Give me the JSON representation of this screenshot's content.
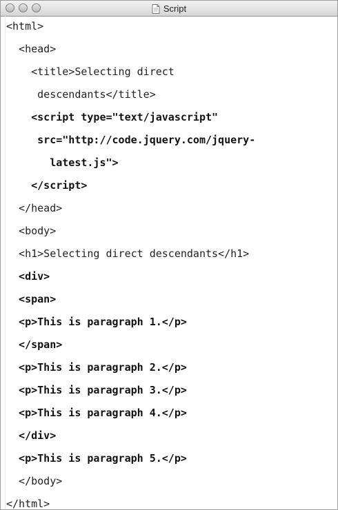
{
  "window": {
    "title": "Script",
    "title_icon": "document-icon"
  },
  "code": {
    "lines": [
      "<html>",
      "  <head>",
      "    <title>Selecting direct",
      "     descendants</title>",
      "    <script type=\"text/javascript\"",
      "     src=\"http://code.jquery.com/jquery-",
      "       latest.js\">",
      "    </script>",
      "  </head>",
      "  <body>",
      "  <h1>Selecting direct descendants</h1>",
      "  <div>",
      "  <span>",
      "  <p>This is paragraph 1.</p>",
      "  </span>",
      "  <p>This is paragraph 2.</p>",
      "  <p>This is paragraph 3.</p>",
      "  <p>This is paragraph 4.</p>",
      "  </div>",
      "  <p>This is paragraph 5.</p>",
      "  </body>",
      "</html>"
    ]
  }
}
